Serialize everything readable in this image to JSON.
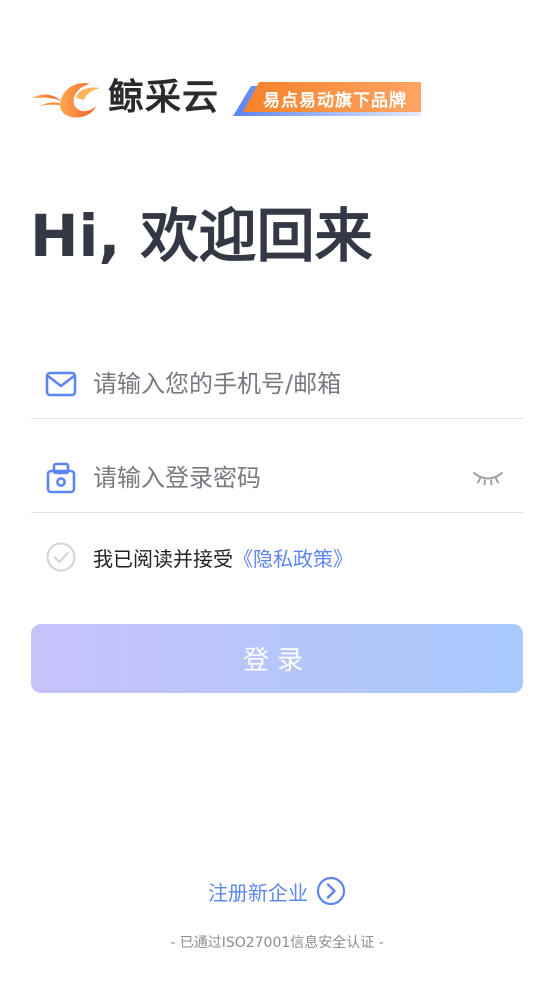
{
  "brand": {
    "name": "鲸采云",
    "tagline": "易点易动旗下品牌",
    "logo_icon": "whale-flame-logo-icon"
  },
  "welcome": "Hi, 欢迎回来",
  "form": {
    "account_placeholder": "请输入您的手机号/邮箱",
    "account_icon": "mail-icon",
    "password_placeholder": "请输入登录密码",
    "password_icon": "lock-icon",
    "password_toggle_icon": "eye-closed-icon",
    "agree_prefix": "我已阅读并接受",
    "policy_link": "《隐私政策》",
    "agree_checked": false,
    "login_label": "登录"
  },
  "footer": {
    "register_label": "注册新企业",
    "register_icon": "chevron-right-circle-icon",
    "iso_note": "- 已通过ISO27001信息安全认证 -"
  },
  "colors": {
    "accent": "#5d86f0",
    "brand_orange": "#f5822a",
    "title": "#343844",
    "button_gradient_start": "#c8c2fb",
    "button_gradient_end": "#a8c9fd"
  }
}
